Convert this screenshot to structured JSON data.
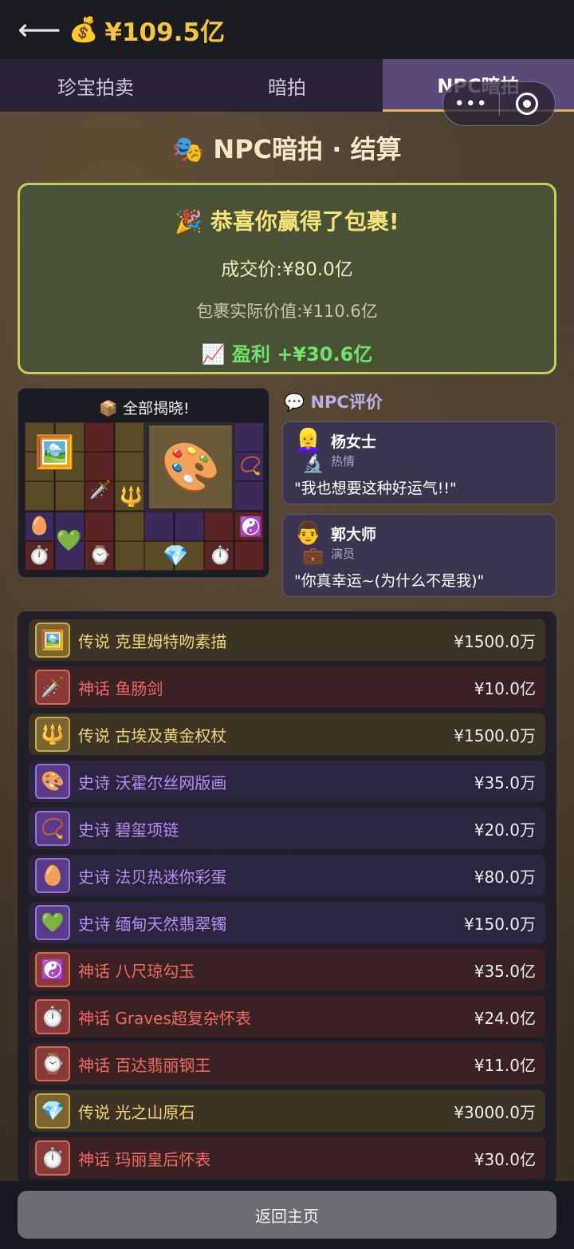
{
  "header": {
    "back_icon": "arrow-left-icon",
    "money_icon": "money-bag-icon",
    "balance": "¥109.5亿"
  },
  "tabs": [
    {
      "label": "珍宝拍卖",
      "active": false
    },
    {
      "label": "暗拍",
      "active": false
    },
    {
      "label": "NPC暗拍",
      "active": true
    }
  ],
  "capsule": {
    "more": "•••",
    "close_icon": "target-icon"
  },
  "title": {
    "icon": "theater-masks-icon",
    "text": "NPC暗拍 · 结算"
  },
  "result": {
    "congrats": "🎉 恭喜你赢得了包裹!",
    "price": "成交价:¥80.0亿",
    "actual_value": "包裹实际价值:¥110.6亿",
    "profit": "📈 盈利 +¥30.6亿",
    "accent": "#c8cc5c"
  },
  "grid": {
    "title": "📦 全部揭晓!"
  },
  "npc": {
    "title": "💬 NPC评价",
    "reviews": [
      {
        "avatar": "👱‍♀️",
        "tool": "🔬",
        "name": "杨女士",
        "role": "热情",
        "quote": "\"我也想要这种好运气!!\""
      },
      {
        "avatar": "👨",
        "tool": "💼",
        "name": "郭大师",
        "role": "演员",
        "quote": "\"你真幸运~(为什么不是我)\""
      }
    ]
  },
  "items": [
    {
      "rarity": "传说",
      "name": "克里姆特吻素描",
      "price": "¥1500.0万",
      "tier": "legend",
      "icon": "🖼️"
    },
    {
      "rarity": "神话",
      "name": "鱼肠剑",
      "price": "¥10.0亿",
      "tier": "myth",
      "icon": "🗡️"
    },
    {
      "rarity": "传说",
      "name": "古埃及黄金权杖",
      "price": "¥1500.0万",
      "tier": "legend",
      "icon": "🔱"
    },
    {
      "rarity": "史诗",
      "name": "沃霍尔丝网版画",
      "price": "¥35.0万",
      "tier": "epic",
      "icon": "🎨"
    },
    {
      "rarity": "史诗",
      "name": "碧玺项链",
      "price": "¥20.0万",
      "tier": "epic",
      "icon": "📿"
    },
    {
      "rarity": "史诗",
      "name": "法贝热迷你彩蛋",
      "price": "¥80.0万",
      "tier": "epic",
      "icon": "🥚"
    },
    {
      "rarity": "史诗",
      "name": "缅甸天然翡翠镯",
      "price": "¥150.0万",
      "tier": "epic",
      "icon": "💚"
    },
    {
      "rarity": "神话",
      "name": "八尺琼勾玉",
      "price": "¥35.0亿",
      "tier": "myth",
      "icon": "☯️"
    },
    {
      "rarity": "神话",
      "name": "Graves超复杂怀表",
      "price": "¥24.0亿",
      "tier": "myth",
      "icon": "⏱️"
    },
    {
      "rarity": "神话",
      "name": "百达翡丽钢王",
      "price": "¥11.0亿",
      "tier": "myth",
      "icon": "⌚"
    },
    {
      "rarity": "传说",
      "name": "光之山原石",
      "price": "¥3000.0万",
      "tier": "legend",
      "icon": "💎"
    },
    {
      "rarity": "神话",
      "name": "玛丽皇后怀表",
      "price": "¥30.0亿",
      "tier": "myth",
      "icon": "⏱️"
    }
  ],
  "bottom": {
    "home_label": "返回主页"
  },
  "colors": {
    "legend": "#f1d27a",
    "myth": "#f06a62",
    "epic": "#b98cf0",
    "balance": "#f5c542"
  }
}
